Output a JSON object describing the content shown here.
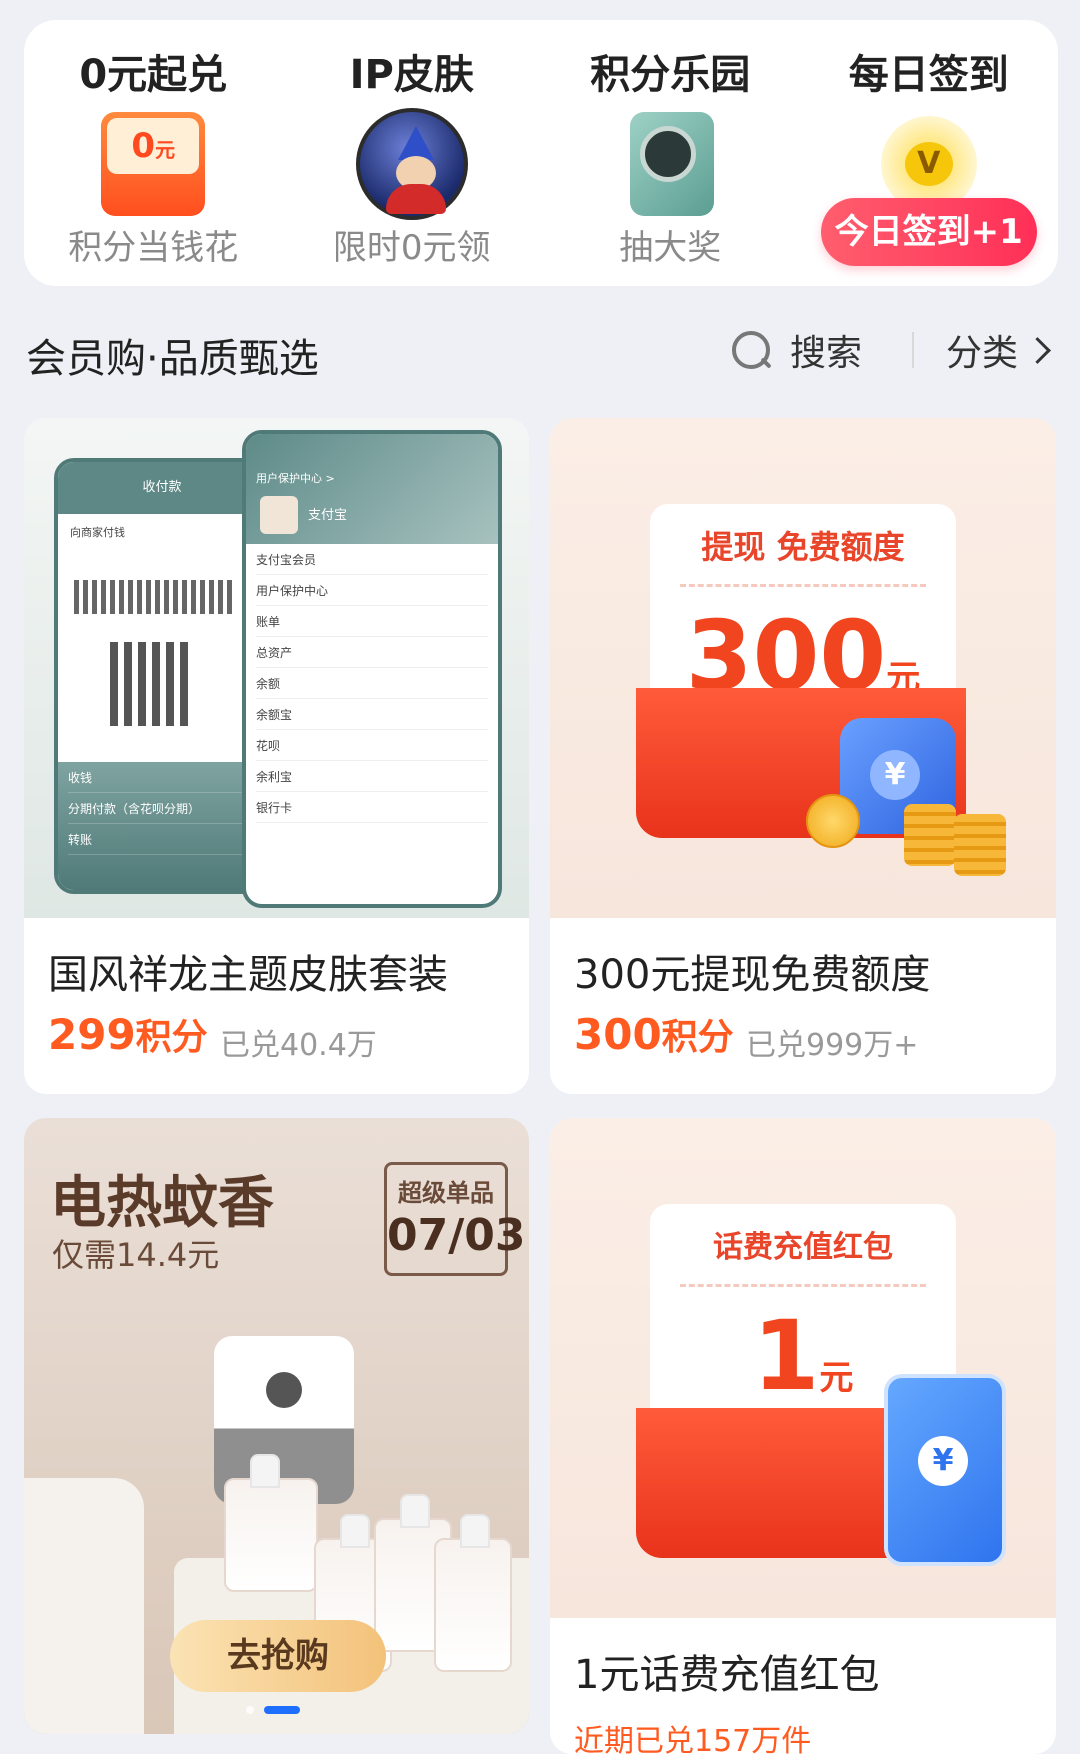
{
  "benefits": [
    {
      "title": "0元起兑",
      "subtitle": "积分当钱花",
      "icon": "zero-yuan-coupon-icon",
      "badge_text": "0",
      "badge_unit": "元"
    },
    {
      "title": "IP皮肤",
      "subtitle": "限时0元领",
      "icon": "ip-character-avatar"
    },
    {
      "title": "积分乐园",
      "subtitle": "抽大奖",
      "icon": "phone-prize-icon"
    },
    {
      "title": "每日签到",
      "action": "今日签到+1",
      "icon": "v-coin-icon",
      "icon_text": "V"
    }
  ],
  "section": {
    "title": "会员购·品质甄选",
    "search_label": "搜索",
    "category_label": "分类"
  },
  "products": [
    {
      "name": "国风祥龙主题皮肤套装",
      "price_value": "299",
      "price_unit": "积分",
      "sold": "已兑40.4万",
      "mock": {
        "left_title": "收付款",
        "left_row": "向商家付钱",
        "right_header": "用户保护中心 >",
        "right_user": "支付宝",
        "right_rows": [
          "支付宝会员",
          "用户保护中心",
          "账单",
          "总资产",
          "余额",
          "余额宝",
          "花呗",
          "余利宝",
          "银行卡"
        ],
        "left_rows": [
          "收钱",
          "分期付款（含花呗分期）",
          "转账"
        ]
      }
    },
    {
      "name": "300元提现免费额度",
      "price_value": "300",
      "price_unit": "积分",
      "sold": "已兑999万+",
      "ticket_title": "提现 免费额度",
      "ticket_amount": "300",
      "ticket_unit": "元",
      "wallet_symbol": "¥"
    },
    {
      "ad_title": "电热蚊香",
      "ad_sub": "仅需14.4元",
      "badge_top": "超级单品",
      "badge_date": "07/03",
      "button": "去抢购"
    },
    {
      "name": "1元话费充值红包",
      "recent": "近期已兑157万件",
      "ticket_title": "话费充值红包",
      "ticket_amount": "1",
      "ticket_unit": "元",
      "phone_symbol": "¥"
    }
  ],
  "colors": {
    "accent_orange": "#ff5a1f",
    "signin_red": "#ff2f57",
    "page_bg": "#eef0f5",
    "carousel_active": "#1f6fff"
  }
}
